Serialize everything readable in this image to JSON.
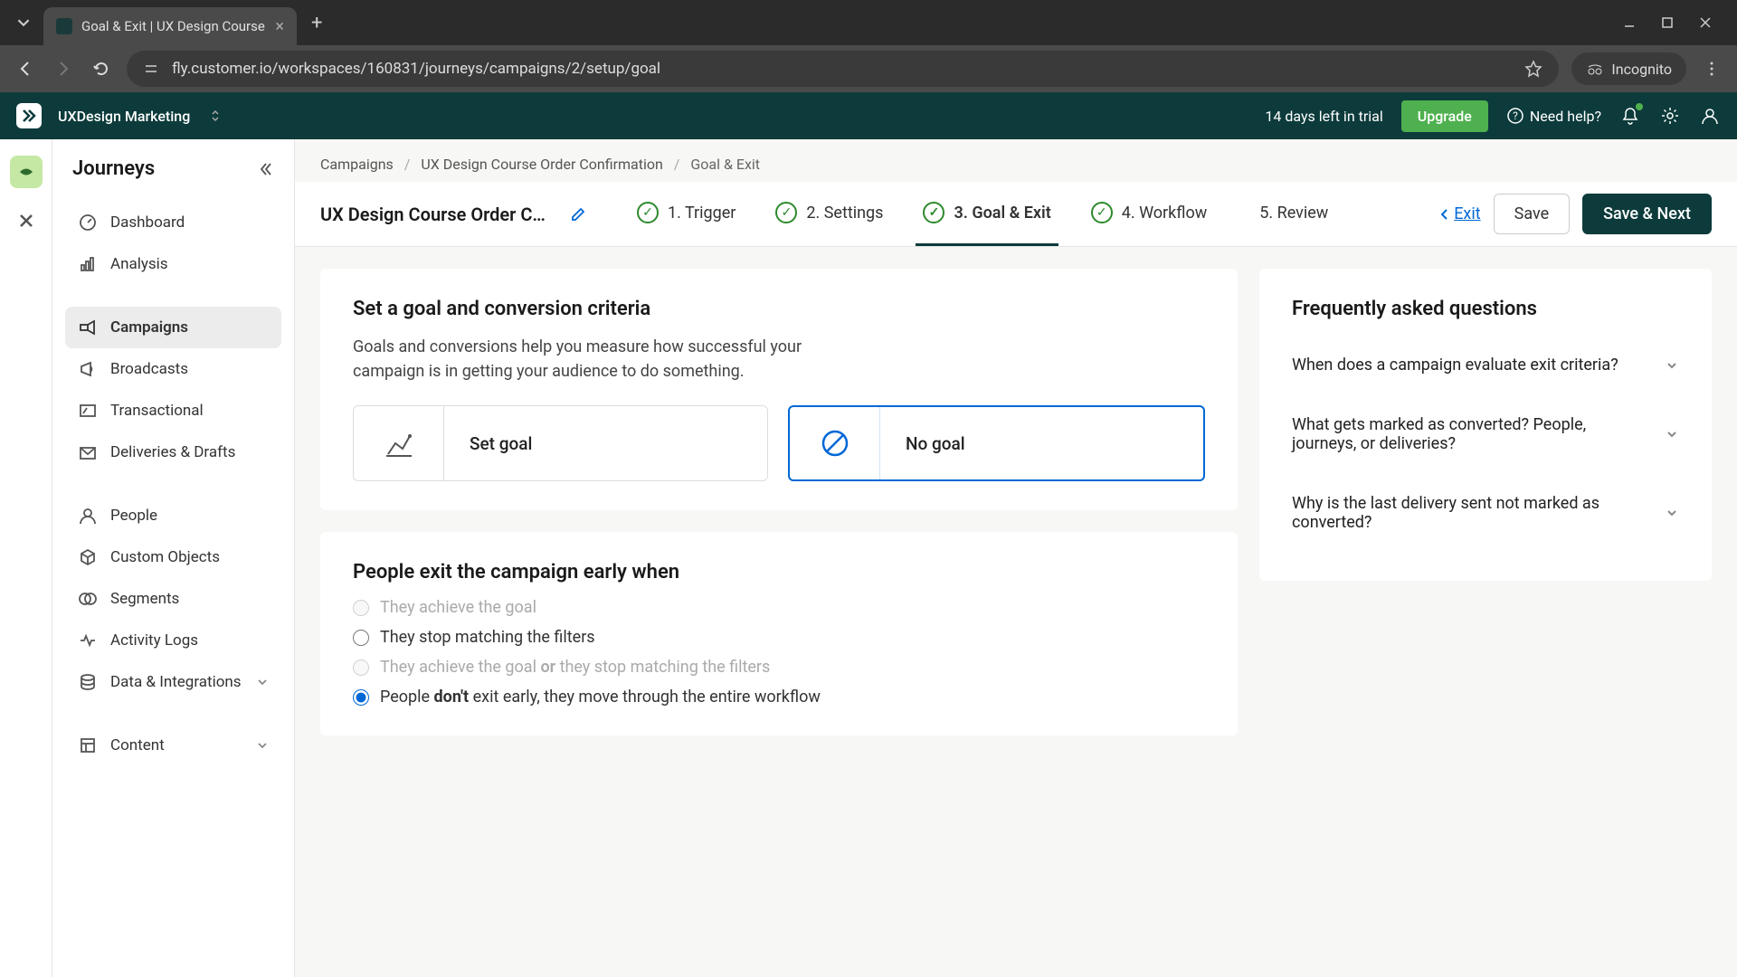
{
  "browser": {
    "tab_title": "Goal & Exit | UX Design Course",
    "url": "fly.customer.io/workspaces/160831/journeys/campaigns/2/setup/goal",
    "incognito": "Incognito"
  },
  "header": {
    "workspace": "UXDesign Marketing",
    "trial": "14 days left in trial",
    "upgrade": "Upgrade",
    "help": "Need help?"
  },
  "sidebar": {
    "title": "Journeys",
    "items": {
      "dashboard": "Dashboard",
      "analysis": "Analysis",
      "campaigns": "Campaigns",
      "broadcasts": "Broadcasts",
      "transactional": "Transactional",
      "deliveries": "Deliveries & Drafts",
      "people": "People",
      "custom_objects": "Custom Objects",
      "segments": "Segments",
      "activity_logs": "Activity Logs",
      "data_integrations": "Data & Integrations",
      "content": "Content"
    }
  },
  "breadcrumb": {
    "campaigns": "Campaigns",
    "campaign_name": "UX Design Course Order Confirmation",
    "current": "Goal & Exit"
  },
  "setup": {
    "title": "UX Design Course Order Confi…",
    "steps": {
      "s1": "1. Trigger",
      "s2": "2. Settings",
      "s3": "3. Goal & Exit",
      "s4": "4. Workflow",
      "s5": "5. Review"
    },
    "exit": "Exit",
    "save": "Save",
    "save_next": "Save & Next"
  },
  "goal_card": {
    "title": "Set a goal and conversion criteria",
    "desc": "Goals and conversions help you measure how successful your campaign is in getting your audience to do something.",
    "set_goal": "Set goal",
    "no_goal": "No goal"
  },
  "exit_card": {
    "title": "People exit the campaign early when",
    "opt1": "They achieve the goal",
    "opt2": "They stop matching the filters",
    "opt3_a": "They achieve the goal ",
    "opt3_or": "or",
    "opt3_b": " they stop matching the filters",
    "opt4_a": "People ",
    "opt4_b": "don't",
    "opt4_c": " exit early, they move through the entire workflow"
  },
  "faq": {
    "title": "Frequently asked questions",
    "q1": "When does a campaign evaluate exit criteria?",
    "q2": "What gets marked as converted? People, journeys, or deliveries?",
    "q3": "Why is the last delivery sent not marked as converted?"
  }
}
